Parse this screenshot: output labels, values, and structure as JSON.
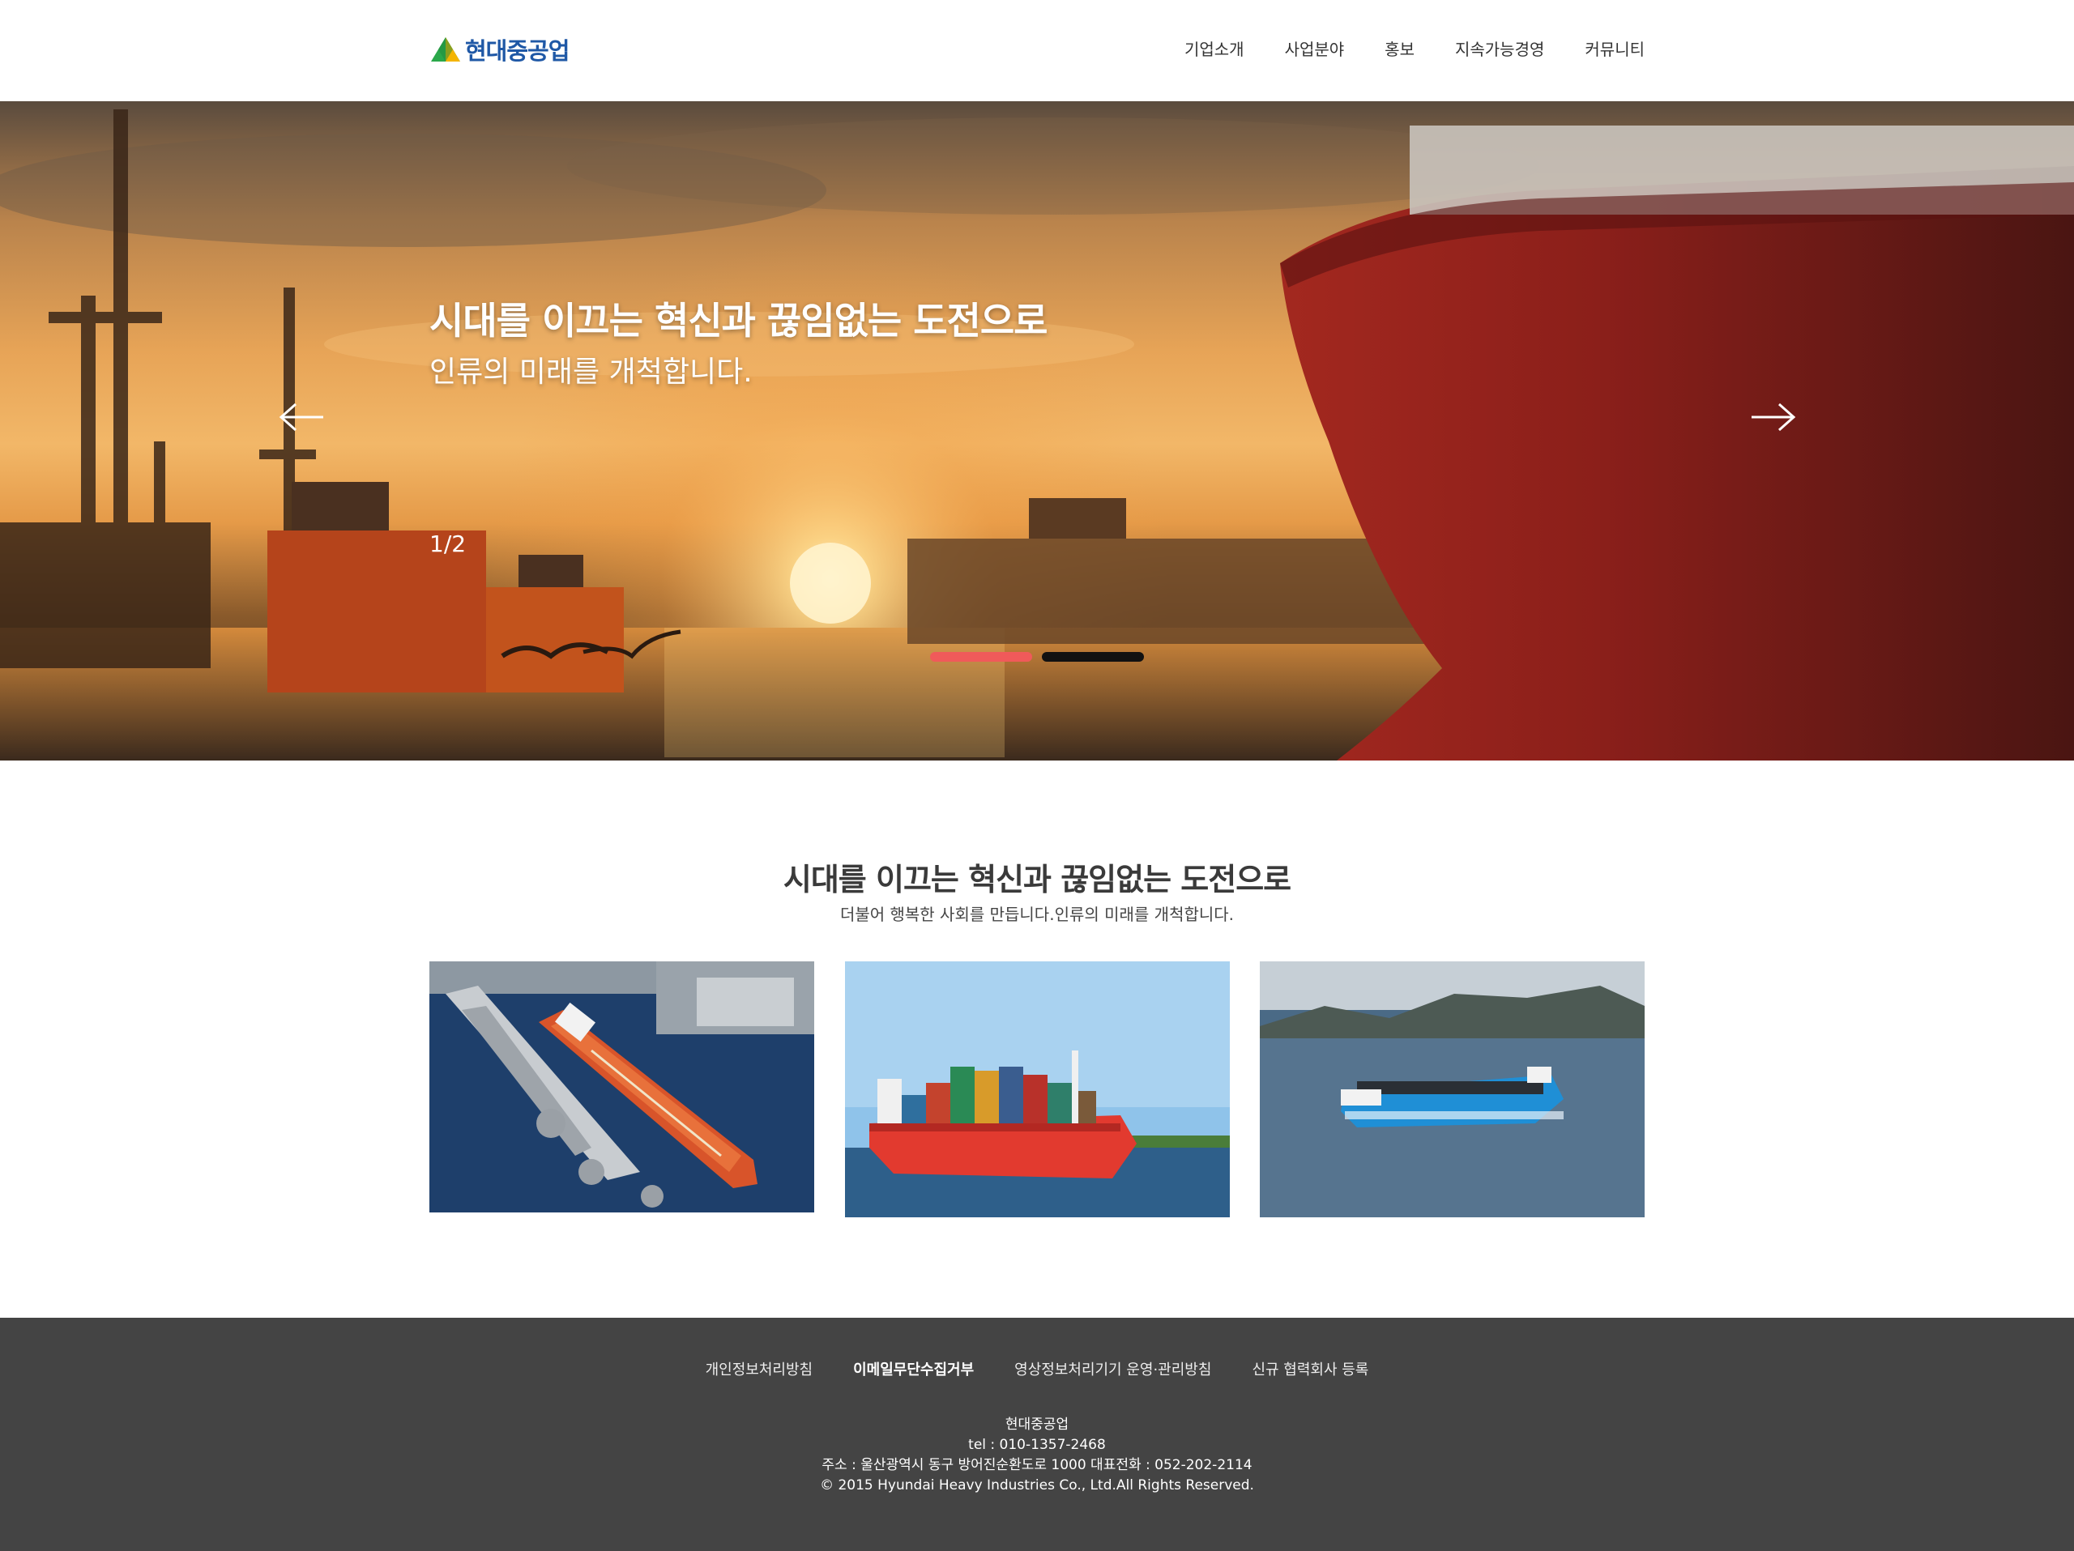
{
  "header": {
    "logo_text": "현대중공업",
    "nav": [
      "기업소개",
      "사업분야",
      "홍보",
      "지속가능경영",
      "커뮤니티"
    ]
  },
  "hero": {
    "title": "시대를 이끄는 혁신과 끊임없는 도전으로",
    "subtitle": "인류의 미래를 개척합니다.",
    "counter": "1/2",
    "active_dot_color": "#f05a5a",
    "inactive_dot_color": "#111111"
  },
  "intro": {
    "title": "시대를 이끄는 혁신과 끊임없는 도전으로",
    "subtitle": "더불어 행복한 사회를 만듭니다.인류의 미래를 개척합니다."
  },
  "cards": [
    {
      "image": "tanker-at-pier-aerial"
    },
    {
      "image": "red-container-ship"
    },
    {
      "image": "blue-electric-container-ship"
    }
  ],
  "footer": {
    "links": [
      "개인정보처리방침",
      "이메일무단수집거부",
      "영상정보처리기기 운영·관리방침",
      "신규 협력회사 등록"
    ],
    "company": "현대중공업",
    "tel": "tel : 010-1357-2468",
    "address": "주소 : 울산광역시 동구 방어진순환도로 1000 대표전화 : 052-202-2114",
    "copyright": "© 2015 Hyundai Heavy Industries Co., Ltd.All Rights Reserved."
  },
  "colors": {
    "brand_blue": "#1f58a6",
    "brand_green": "#2aa84a",
    "footer_bg": "#444444"
  }
}
